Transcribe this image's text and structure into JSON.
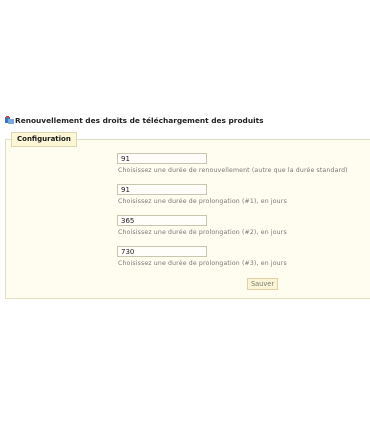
{
  "header": {
    "icon": "module-icon",
    "title": "Renouvellement des droits de téléchargement des produits"
  },
  "config": {
    "legend": "Configuration",
    "fields": [
      {
        "value": "91",
        "help": "Choisissez une durée de renouvellement (autre que la durée standard)"
      },
      {
        "value": "91",
        "help": "Choisissez une durée de prolongation (#1), en jours"
      },
      {
        "value": "365",
        "help": "Choisissez une durée de prolongation (#2), en jours"
      },
      {
        "value": "730",
        "help": "Choisissez une durée de prolongation (#3), en jours"
      }
    ],
    "save_label": "Sauver"
  }
}
